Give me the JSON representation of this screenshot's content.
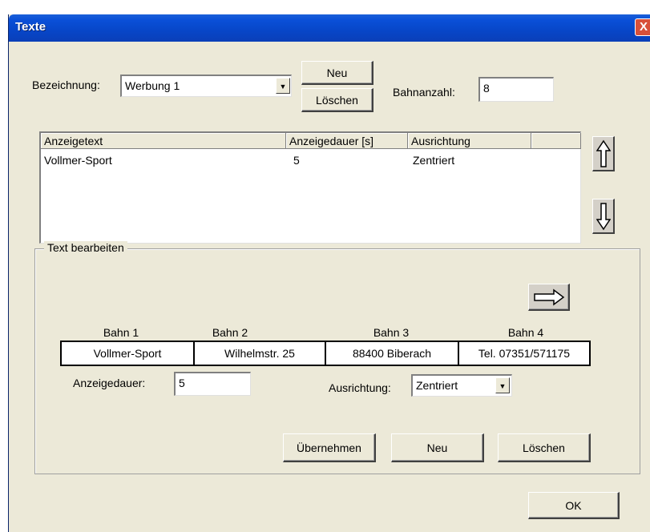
{
  "window": {
    "title": "Texte",
    "close_label": "X"
  },
  "top": {
    "bezeichnung_label": "Bezeichnung:",
    "bezeichnung_value": "Werbung 1",
    "neu_label": "Neu",
    "loeschen_label": "Löschen",
    "bahnanzahl_label": "Bahnanzahl:",
    "bahnanzahl_value": "8"
  },
  "list": {
    "columns": [
      "Anzeigetext",
      "Anzeigedauer [s]",
      "Ausrichtung"
    ],
    "rows": [
      {
        "text": "Vollmer-Sport",
        "dauer": "5",
        "ausrichtung": "Zentriert"
      }
    ]
  },
  "icons": {
    "up": "arrow-up-icon",
    "down": "arrow-down-icon",
    "right": "arrow-right-icon"
  },
  "edit": {
    "group_title": "Text bearbeiten",
    "bahnen": [
      {
        "label": "Bahn 1",
        "value": "Vollmer-Sport"
      },
      {
        "label": "Bahn 2",
        "value": "Wilhelmstr. 25"
      },
      {
        "label": "Bahn 3",
        "value": "88400 Biberach"
      },
      {
        "label": "Bahn 4",
        "value": "Tel. 07351/571175"
      }
    ],
    "anzeigedauer_label": "Anzeigedauer:",
    "anzeigedauer_value": "5",
    "ausrichtung_label": "Ausrichtung:",
    "ausrichtung_value": "Zentriert",
    "uebernehmen_label": "Übernehmen",
    "neu_label": "Neu",
    "loeschen_label": "Löschen"
  },
  "ok_label": "OK"
}
